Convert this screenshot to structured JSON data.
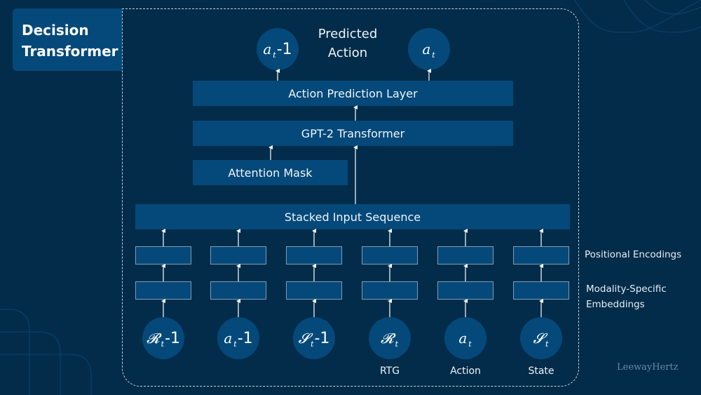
{
  "title": {
    "line1": "Decision",
    "line2": "Transformer"
  },
  "predicted_action_label": {
    "line1": "Predicted",
    "line2": "Action"
  },
  "outputs": [
    {
      "symbol": "a",
      "subscript": "t",
      "suffix": "-1"
    },
    {
      "symbol": "a",
      "subscript": "t",
      "suffix": ""
    }
  ],
  "layers": {
    "action_prediction": "Action Prediction Layer",
    "gpt2": "GPT-2 Transformer",
    "attention_mask": "Attention Mask",
    "stacked_input": "Stacked Input Sequence"
  },
  "side_labels": {
    "positional": "Positional Encodings",
    "modality_line1": "Modality-Specific",
    "modality_line2": "Embeddings"
  },
  "inputs": [
    {
      "symbol": "𝓡",
      "subscript": "t",
      "suffix": "-1",
      "caption": ""
    },
    {
      "symbol": "a",
      "subscript": "t",
      "suffix": "-1",
      "caption": ""
    },
    {
      "symbol": "𝓢",
      "subscript": "t",
      "suffix": "-1",
      "caption": ""
    },
    {
      "symbol": "𝓡",
      "subscript": "t",
      "suffix": "",
      "caption": "RTG"
    },
    {
      "symbol": "a",
      "subscript": "t",
      "suffix": "",
      "caption": "Action"
    },
    {
      "symbol": "𝓢",
      "subscript": "t",
      "suffix": "",
      "caption": "State"
    }
  ],
  "watermark": "LeewayHertz",
  "colors": {
    "background": "#022c4a",
    "box": "#04497a",
    "box_border": "#7f9db5",
    "dashed_border": "#c9d3db",
    "text": "#ffffff"
  }
}
